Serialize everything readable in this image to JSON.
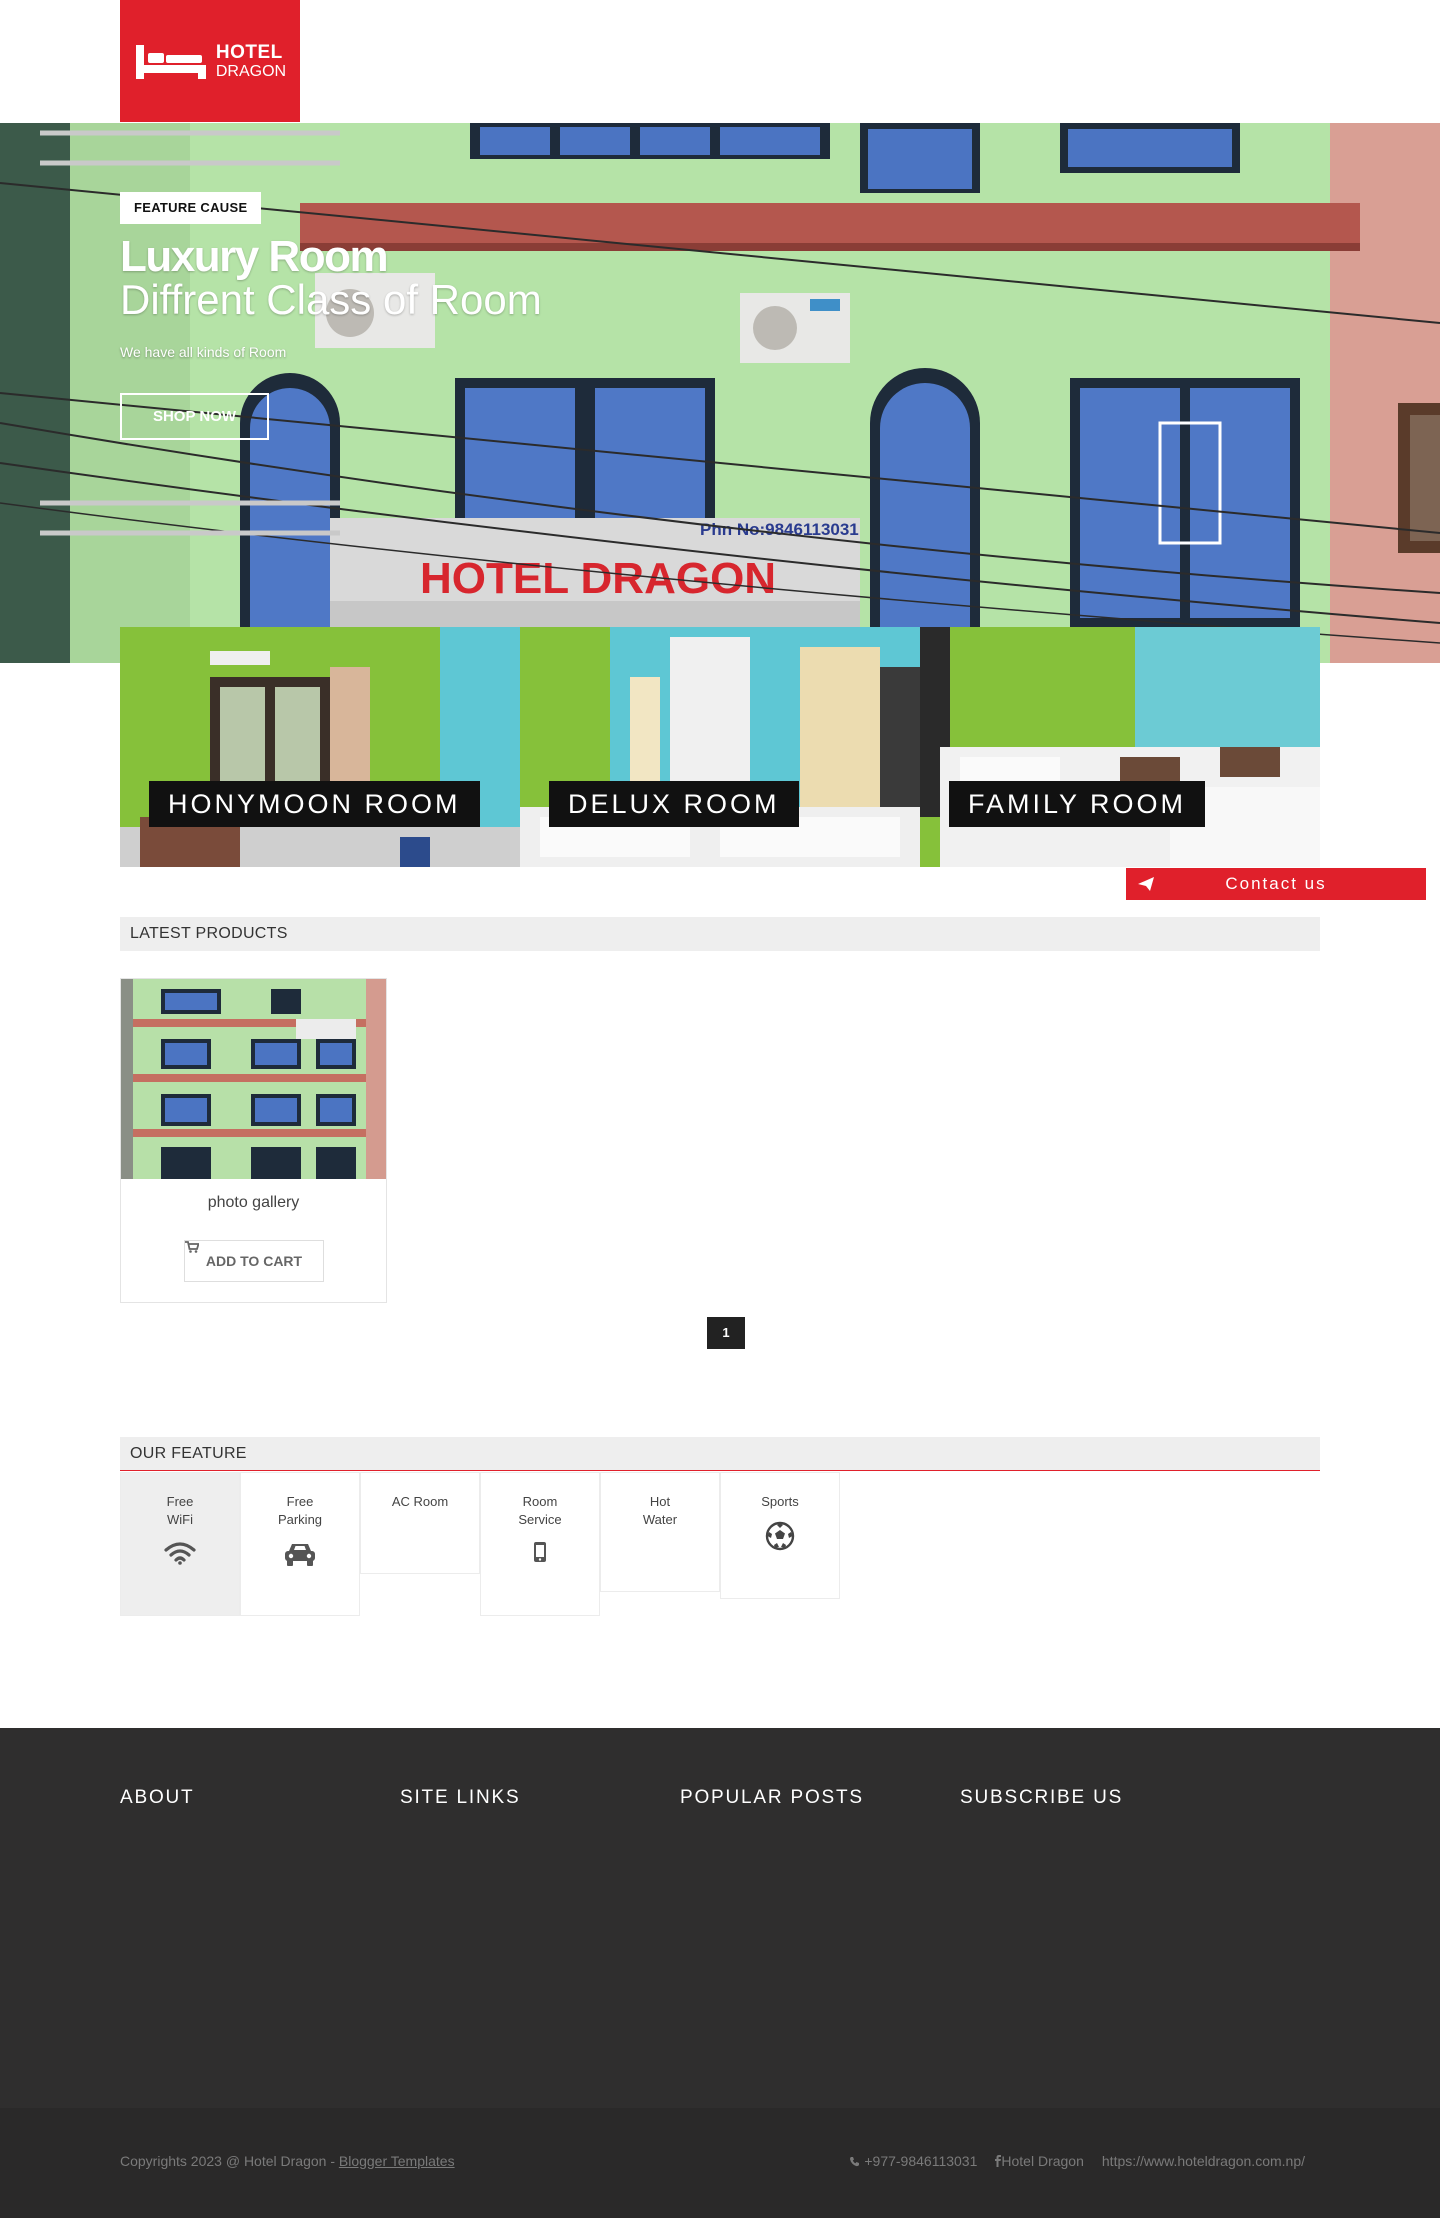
{
  "brand": {
    "line1": "HOTEL",
    "line2": "DRAGON",
    "accent": "#e0202b"
  },
  "hero": {
    "tag": "FEATURE CAUSE",
    "title": "Luxury Room",
    "subtitle": "Diffrent Class of Room",
    "description": "We have all kinds of Room",
    "button": "SHOP NOW"
  },
  "rooms": [
    {
      "label": "HONYMOON ROOM"
    },
    {
      "label": "DELUX ROOM"
    },
    {
      "label": "FAMILY ROOM"
    }
  ],
  "contact_button": "Contact us",
  "latest": {
    "heading": "LATEST PRODUCTS",
    "products": [
      {
        "name": "photo gallery",
        "button": "ADD TO CART"
      }
    ],
    "page": "1"
  },
  "features": {
    "heading": "OUR FEATURE",
    "items": [
      {
        "line1": "Free",
        "line2": "WiFi",
        "icon": "wifi-icon"
      },
      {
        "line1": "Free",
        "line2": "Parking",
        "icon": "car-icon"
      },
      {
        "line1": "AC Room",
        "line2": "",
        "icon": ""
      },
      {
        "line1": "Room",
        "line2": "Service",
        "icon": "mobile-icon"
      },
      {
        "line1": "Hot",
        "line2": "Water",
        "icon": ""
      },
      {
        "line1": "Sports",
        "line2": "",
        "icon": "soccer-ball-icon"
      }
    ]
  },
  "footer": {
    "columns": [
      "ABOUT",
      "SITE LINKS",
      "POPULAR POSTS",
      "SUBSCRIBE US"
    ],
    "copyright": "Copyrights 2023 @ Hotel Dragon - ",
    "template_link": "Blogger Templates",
    "phone": "+977-9846113031",
    "facebook": "Hotel Dragon",
    "website": "https://www.hoteldragon.com.np/"
  },
  "hero_sign": {
    "phone": "Phn No:9846113031",
    "name": "HOTEL DRAGON"
  }
}
